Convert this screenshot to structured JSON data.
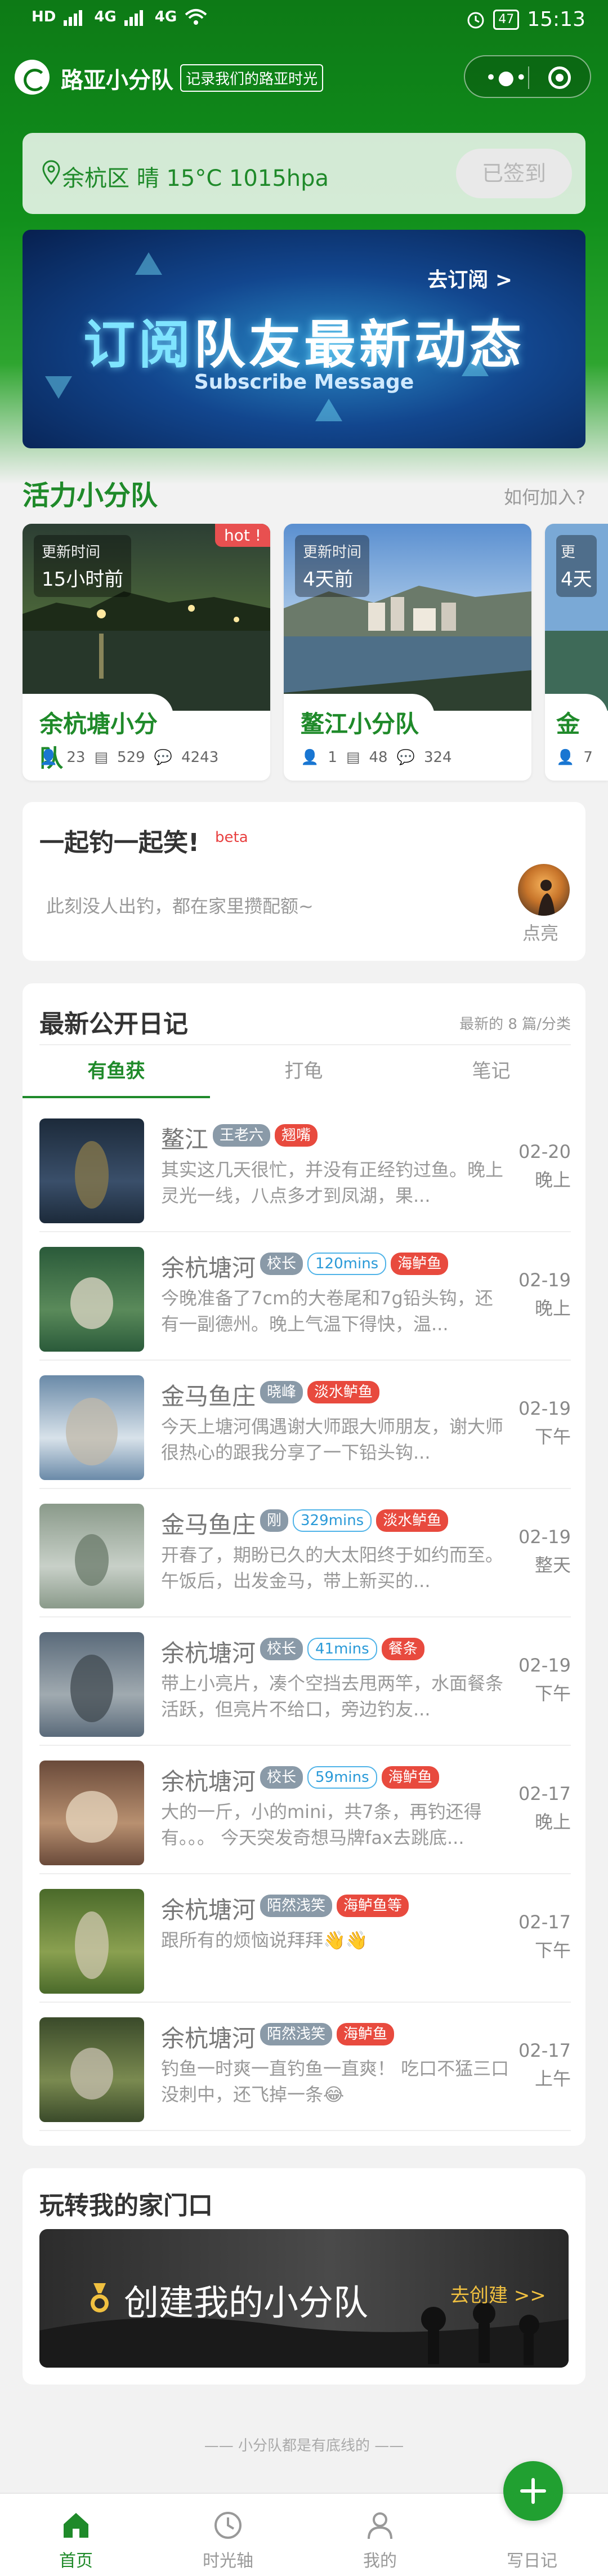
{
  "status_bar": {
    "network_left": "HD",
    "signal_1": "4G",
    "signal_2": "4G",
    "battery": "47",
    "time": "15:13"
  },
  "header": {
    "app_title": "路亚小分队",
    "slogan": "记录我们的路亚时光"
  },
  "weather": {
    "text": "余杭区 晴 15°C 1015hpa",
    "signed_button": "已签到"
  },
  "banner": {
    "goto": "去订阅 >",
    "title_highlight": "订阅",
    "title_rest": "队友最新动态",
    "subtitle": "Subscribe Message"
  },
  "teams_section": {
    "title": "活力小分队",
    "join_link": "如何加入?"
  },
  "teams": [
    {
      "updated_label": "更新时间",
      "updated_value": "15小时前",
      "hot": "hot !",
      "name": "余杭塘小分队",
      "members": "23",
      "posts": "529",
      "comments": "4243"
    },
    {
      "updated_label": "更新时间",
      "updated_value": "4天前",
      "name": "鳌江小分队",
      "members": "1",
      "posts": "48",
      "comments": "324"
    },
    {
      "updated_label": "更",
      "updated_value": "4天",
      "name": "金",
      "members": "7"
    }
  ],
  "fish_together": {
    "title": "一起钓一起笑!",
    "beta": "beta",
    "empty": "此刻没人出钓，都在家里攒配额~",
    "light_up": "点亮"
  },
  "diary": {
    "title": "最新公开日记",
    "recent": "最新的 8 篇/分类",
    "tabs": [
      "有鱼获",
      "打龟",
      "笔记"
    ],
    "entries": [
      {
        "place": "鳌江",
        "tags": [
          {
            "text": "王老六",
            "style": "gray"
          },
          {
            "text": "翘嘴",
            "style": "red"
          }
        ],
        "desc": "其实这几天很忙，并没有正经钓过鱼。晚上灵光一线，八点多才到凤湖，果...",
        "date": "02-20",
        "time": "晚上"
      },
      {
        "place": "余杭塘河",
        "tags": [
          {
            "text": "校长",
            "style": "gray"
          },
          {
            "text": "120mins",
            "style": "outline"
          },
          {
            "text": "海鲈鱼",
            "style": "red"
          }
        ],
        "desc": "今晚准备了7cm的大卷尾和7g铅头钩，还有一副德州。晚上气温下得快，温...",
        "date": "02-19",
        "time": "晚上"
      },
      {
        "place": "金马鱼庄",
        "tags": [
          {
            "text": "晓峰",
            "style": "gray"
          },
          {
            "text": "淡水鲈鱼",
            "style": "red"
          }
        ],
        "desc": "今天上塘河偶遇谢大师跟大师朋友，谢大师很热心的跟我分享了一下铅头钩...",
        "date": "02-19",
        "time": "下午"
      },
      {
        "place": "金马鱼庄",
        "tags": [
          {
            "text": "刚",
            "style": "gray"
          },
          {
            "text": "329mins",
            "style": "outline"
          },
          {
            "text": "淡水鲈鱼",
            "style": "red"
          }
        ],
        "desc": "开春了，期盼已久的大太阳终于如约而至。 午饭后，出发金马，带上新买的...",
        "date": "02-19",
        "time": "整天"
      },
      {
        "place": "余杭塘河",
        "tags": [
          {
            "text": "校长",
            "style": "gray"
          },
          {
            "text": "41mins",
            "style": "outline"
          },
          {
            "text": "餐条",
            "style": "red"
          }
        ],
        "desc": "带上小亮片，凑个空挡去甩两竿，水面餐条活跃，但亮片不给口，旁边钓友...",
        "date": "02-19",
        "time": "下午"
      },
      {
        "place": "余杭塘河",
        "tags": [
          {
            "text": "校长",
            "style": "gray"
          },
          {
            "text": "59mins",
            "style": "outline"
          },
          {
            "text": "海鲈鱼",
            "style": "red"
          }
        ],
        "desc": "大的一斤，小的mini，共7条，再钓还得有。。。 今天突发奇想马牌fax去跳底...",
        "date": "02-17",
        "time": "晚上"
      },
      {
        "place": "余杭塘河",
        "tags": [
          {
            "text": "陌然浅笑",
            "style": "gray"
          },
          {
            "text": "海鲈鱼等",
            "style": "red"
          }
        ],
        "desc": "跟所有的烦恼说拜拜👋👋",
        "date": "02-17",
        "time": "下午"
      },
      {
        "place": "余杭塘河",
        "tags": [
          {
            "text": "陌然浅笑",
            "style": "gray"
          },
          {
            "text": "海鲈鱼",
            "style": "red"
          }
        ],
        "desc": "钓鱼一时爽一直钓鱼一直爽！ 吃口不猛三口没刺中，还飞掉一条😂",
        "date": "02-17",
        "time": "上午"
      }
    ]
  },
  "home_section": {
    "title": "玩转我的家门口",
    "create_text": "创建我的小分队",
    "create_link": "去创建 >>"
  },
  "footer": "—— 小分队都是有底线的 ——",
  "tabbar": [
    {
      "label": "首页",
      "icon": "home-icon"
    },
    {
      "label": "时光轴",
      "icon": "clock-icon"
    },
    {
      "label": "我的",
      "icon": "person-icon"
    },
    {
      "label": "写日记",
      "icon": "plus-icon"
    }
  ],
  "colors": {
    "brand_green": "#1f8a2a",
    "tag_red": "#e84a3e",
    "tag_gray": "#8a9aa8",
    "tag_outline": "#4fb3e8"
  }
}
